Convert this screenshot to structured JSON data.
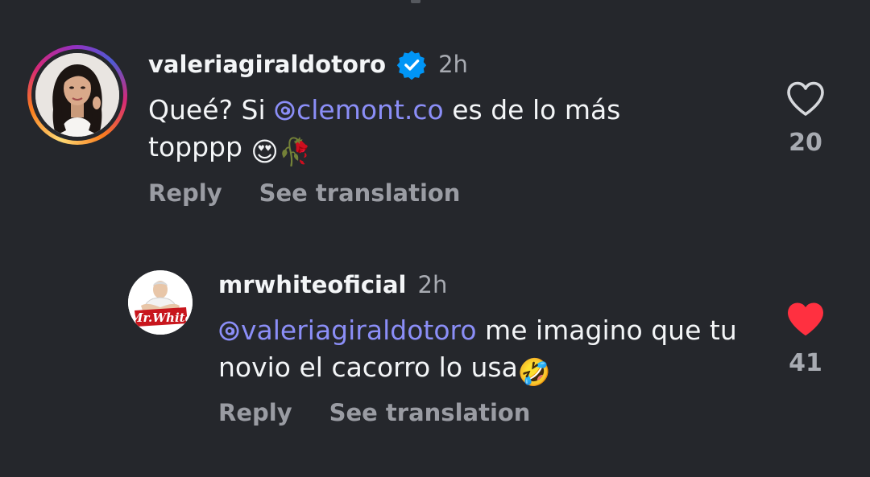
{
  "theme": {
    "background": "#25272c",
    "primary_text": "#f3f5f7",
    "secondary_text": "#a8abb2",
    "mention_color": "#8b8ef7",
    "like_active_color": "#ff3040",
    "verified_color": "#0095f6"
  },
  "comments": [
    {
      "username": "valeriagiraldotoro",
      "verified": true,
      "verified_icon": "verified-badge-icon",
      "time": "2h",
      "avatar": "profile-photo-with-story-ring",
      "text_before": "Queé? Si ",
      "mention": "clemont.co",
      "text_after": " es de lo más topppp ",
      "emojis": "😍🥀",
      "actions": {
        "reply": "Reply",
        "translate": "See translation"
      },
      "like_icon": "heart-outline-icon",
      "liked": false,
      "likes": "20"
    },
    {
      "username": "mrwhiteoficial",
      "verified": false,
      "time": "2h",
      "avatar": "brand-logo",
      "avatar_logo_text": "Mr.White",
      "mention": "valeriagiraldotoro",
      "text_after": " me imagino que tu novio el cacorro lo usa",
      "emojis": "🤣",
      "actions": {
        "reply": "Reply",
        "translate": "See translation"
      },
      "like_icon": "heart-filled-icon",
      "liked": true,
      "likes": "41"
    }
  ]
}
